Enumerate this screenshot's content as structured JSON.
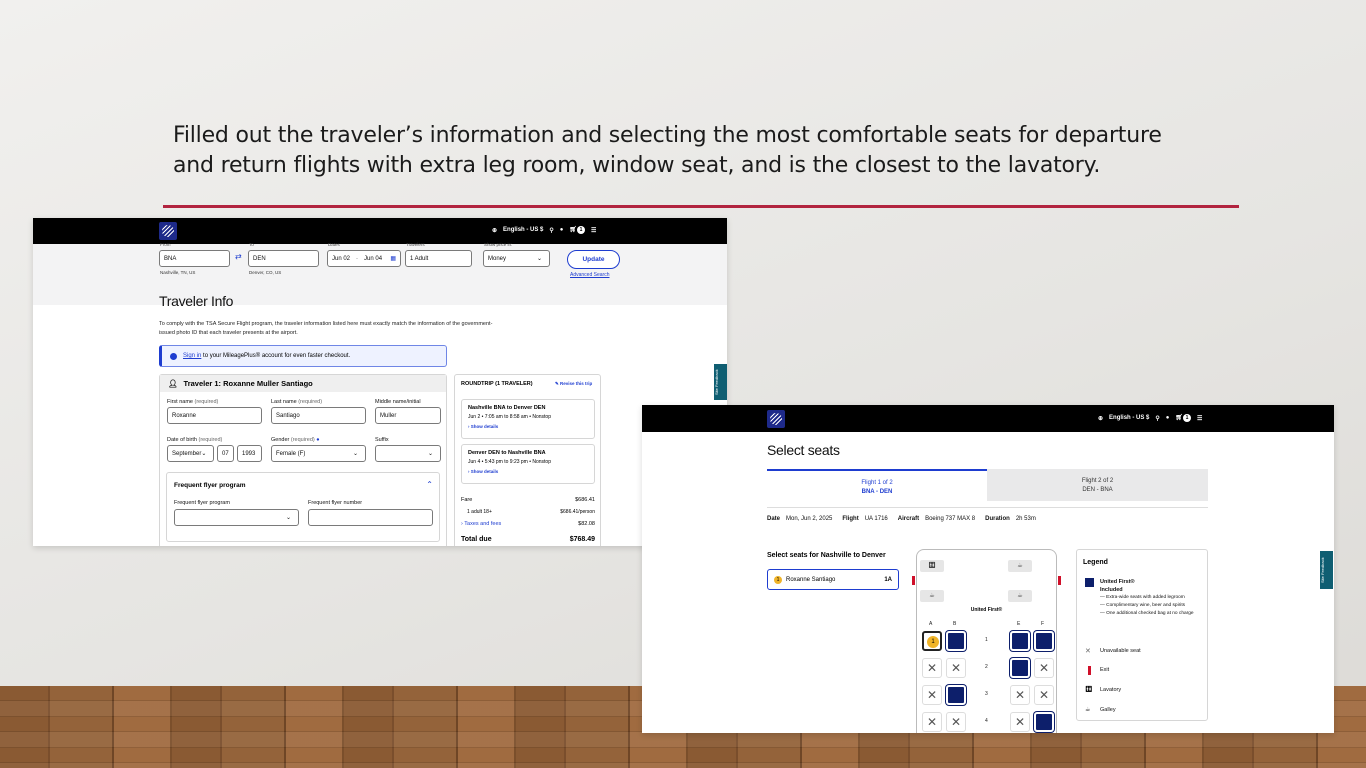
{
  "slide": {
    "caption": "Filled out the traveler’s information and selecting the most comfortable seats for departure and return flights with extra leg room, window seat, and is the closest to the lavatory."
  },
  "header": {
    "language": "English - US $",
    "cart_count": "1"
  },
  "traveler_page": {
    "search": {
      "from_label": "From",
      "from_value": "BNA",
      "from_sub": "Nashville, TN, US",
      "to_label": "To",
      "to_value": "DEN",
      "to_sub": "Denver, CO, US",
      "dates_label": "Dates",
      "depart_date": "Jun 02",
      "return_date": "Jun 04",
      "travelers_label": "Travelers",
      "travelers_value": "1 Adult",
      "price_label": "Show price in:",
      "price_value": "Money",
      "update_button": "Update",
      "advanced_search": "Advanced Search"
    },
    "title": "Traveler Info",
    "notice": "To comply with the TSA Secure Flight program, the traveler information listed here must exactly match the information of the government-issued photo ID that each traveler presents at the airport.",
    "signin_link": "Sign in",
    "signin_rest": "to your MileagePlus® account for even faster checkout.",
    "traveler_title": "Traveler 1: Roxanne Muller Santiago",
    "first_name_label": "First name",
    "last_name_label": "Last name",
    "middle_name_label": "Middle name/initial",
    "required_text": "(required)",
    "first_name": "Roxanne",
    "last_name": "Santiago",
    "middle_name": "Muller",
    "dob_label": "Date of birth",
    "dob_month": "September",
    "dob_day": "07",
    "dob_year": "1993",
    "gender_label": "Gender",
    "gender_value": "Female (F)",
    "suffix_label": "Suffix",
    "suffix_value": "",
    "ffp_title": "Frequent flyer program",
    "ffp_program_label": "Frequent flyer program",
    "ffp_number_label": "Frequent flyer number",
    "summary": {
      "title": "ROUNDTRIP (1 TRAVELER)",
      "revise": "Revise this trip",
      "leg1_title": "Nashville BNA to Denver DEN",
      "leg1_detail": "Jun 2 • 7:05 am to 8:58 am • Nonstop",
      "leg2_title": "Denver DEN to Nashville BNA",
      "leg2_detail": "Jun 4 • 5:43 pm to 9:23 pm • Nonstop",
      "show_details": "Show details",
      "fare_label": "Fare",
      "fare_value": "$686.41",
      "adult_label": "1 adult 18+",
      "adult_value": "$686.41/person",
      "taxes_label": "Taxes and fees",
      "taxes_value": "$82.08",
      "total_label": "Total due",
      "total_value": "$768.49"
    },
    "feedback_tab": "Site Feedback"
  },
  "seats_page": {
    "title": "Select seats",
    "tab1_line1": "Flight 1 of 2",
    "tab1_line2": "BNA - DEN",
    "tab2_line1": "Flight 2 of 2",
    "tab2_line2": "DEN - BNA",
    "date_label": "Date",
    "date_value": "Mon, Jun 2, 2025",
    "flight_label": "Flight",
    "flight_value": "UA 1716",
    "aircraft_label": "Aircraft",
    "aircraft_value": "Boeing 737 MAX 8",
    "duration_label": "Duration",
    "duration_value": "2h 53m",
    "select_for": "Select seats for Nashville to Denver",
    "passenger_num": "1",
    "passenger_name": "Roxanne Santiago",
    "passenger_seat": "1A",
    "cabin_label": "United First®",
    "columns": [
      "A",
      "B",
      "E",
      "F"
    ],
    "rows": [
      "1",
      "2",
      "3",
      "4"
    ],
    "legend": {
      "title": "Legend",
      "first_title": "United First®",
      "first_included": "Included",
      "first_b1": "— Extra-wide seats with added legroom",
      "first_b2": "— Complimentary wine, beer and spirits",
      "first_b3": "— One additional checked bag at no charge",
      "unavailable": "Unavailable seat",
      "exit": "Exit",
      "lavatory": "Lavatory",
      "galley": "Galley"
    },
    "feedback_tab": "Site Feedback",
    "colors": {
      "first_class": "#0d1f6b",
      "exit": "#d0102a",
      "accent": "#1e3dd0"
    }
  }
}
